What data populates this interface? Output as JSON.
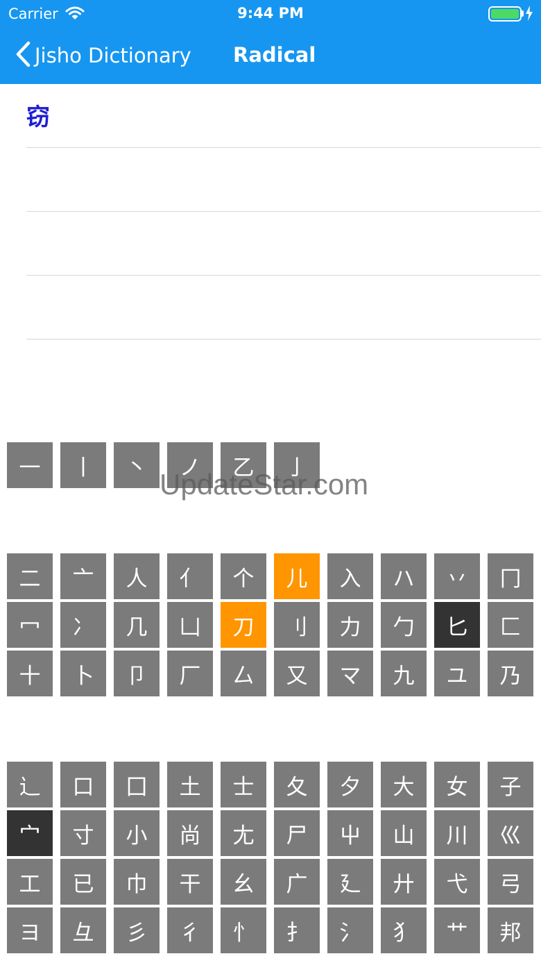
{
  "status_bar": {
    "carrier": "Carrier",
    "time": "9:44 PM"
  },
  "nav": {
    "back_label": "Jisho Dictionary",
    "title": "Radical"
  },
  "results": [
    "窃",
    "",
    "",
    ""
  ],
  "keyboard": {
    "group1": [
      {
        "char": "一"
      },
      {
        "char": "丨"
      },
      {
        "char": "丶"
      },
      {
        "char": "ノ"
      },
      {
        "char": "乙"
      },
      {
        "char": "亅"
      }
    ],
    "group2": [
      {
        "char": "二"
      },
      {
        "char": "亠"
      },
      {
        "char": "人"
      },
      {
        "char": "亻"
      },
      {
        "char": "个"
      },
      {
        "char": "儿",
        "state": "orange"
      },
      {
        "char": "入"
      },
      {
        "char": "ハ"
      },
      {
        "char": "丷"
      },
      {
        "char": "冂"
      },
      {
        "char": "冖"
      },
      {
        "char": "冫"
      },
      {
        "char": "几"
      },
      {
        "char": "凵"
      },
      {
        "char": "刀",
        "state": "orange"
      },
      {
        "char": "刂"
      },
      {
        "char": "力"
      },
      {
        "char": "勹"
      },
      {
        "char": "匕",
        "state": "dark"
      },
      {
        "char": "匚"
      },
      {
        "char": "十"
      },
      {
        "char": "卜"
      },
      {
        "char": "卩"
      },
      {
        "char": "厂"
      },
      {
        "char": "厶"
      },
      {
        "char": "又"
      },
      {
        "char": "マ"
      },
      {
        "char": "九"
      },
      {
        "char": "ユ"
      },
      {
        "char": "乃"
      }
    ],
    "group3": [
      {
        "char": "⻌"
      },
      {
        "char": "口"
      },
      {
        "char": "囗"
      },
      {
        "char": "土"
      },
      {
        "char": "士"
      },
      {
        "char": "夂"
      },
      {
        "char": "夕"
      },
      {
        "char": "大"
      },
      {
        "char": "女"
      },
      {
        "char": "子"
      },
      {
        "char": "宀",
        "state": "dark"
      },
      {
        "char": "寸"
      },
      {
        "char": "小"
      },
      {
        "char": "尚"
      },
      {
        "char": "尢"
      },
      {
        "char": "尸"
      },
      {
        "char": "屮"
      },
      {
        "char": "山"
      },
      {
        "char": "川"
      },
      {
        "char": "巛"
      },
      {
        "char": "工"
      },
      {
        "char": "已"
      },
      {
        "char": "巾"
      },
      {
        "char": "干"
      },
      {
        "char": "幺"
      },
      {
        "char": "广"
      },
      {
        "char": "廴"
      },
      {
        "char": "廾"
      },
      {
        "char": "弋"
      },
      {
        "char": "弓"
      },
      {
        "char": "ヨ"
      },
      {
        "char": "彑"
      },
      {
        "char": "彡"
      },
      {
        "char": "彳"
      },
      {
        "char": "忄"
      },
      {
        "char": "扌"
      },
      {
        "char": "氵"
      },
      {
        "char": "犭"
      },
      {
        "char": "艹"
      },
      {
        "char": "邦"
      }
    ]
  },
  "watermark": "UpdateStar.com",
  "colors": {
    "nav_bg": "#1696f0",
    "key_bg": "#7b7b7b",
    "key_selected": "#ff9500",
    "key_disabled": "#333333",
    "result_text": "#1e1ed2"
  }
}
